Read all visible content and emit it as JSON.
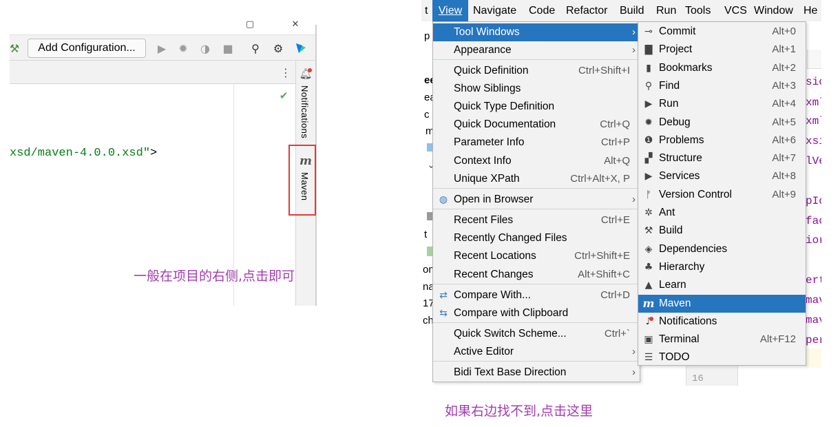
{
  "left": {
    "add_config_label": "Add Configuration...",
    "code_text": "xsd/maven-4.0.0.xsd\"",
    "code_end": ">",
    "notifications_label": "Notifications",
    "maven_label": "Maven",
    "maven_glyph": "m",
    "caption": "一般在项目的右侧,点击即可",
    "check_glyph": "✔",
    "highlight_color": "#e53935"
  },
  "menubar": {
    "items": [
      "t",
      "View",
      "Navigate",
      "Code",
      "Refactor",
      "Build",
      "Run",
      "Tools",
      "VCS",
      "Window",
      "He"
    ]
  },
  "background_fragments": {
    "left_chars": [
      "p",
      "ee",
      "ea",
      "c",
      "m",
      "t",
      "om",
      "na",
      "17",
      "ch"
    ],
    "code_chars": [
      "sic",
      "xml",
      "xml",
      "xsi",
      "lVe",
      "pIc",
      "fac",
      "ior",
      "ert",
      "mav",
      "mav",
      "per"
    ],
    "line_number": "16"
  },
  "view_menu": {
    "items": [
      {
        "label": "Tool Windows",
        "shortcut": "",
        "submenu": true,
        "selected": true
      },
      {
        "label": "Appearance",
        "shortcut": "",
        "submenu": true
      },
      {
        "label": "Quick Definition",
        "shortcut": "Ctrl+Shift+I"
      },
      {
        "label": "Show Siblings",
        "shortcut": ""
      },
      {
        "label": "Quick Type Definition",
        "shortcut": ""
      },
      {
        "label": "Quick Documentation",
        "shortcut": "Ctrl+Q"
      },
      {
        "label": "Parameter Info",
        "shortcut": "Ctrl+P"
      },
      {
        "label": "Context Info",
        "shortcut": "Alt+Q"
      },
      {
        "label": "Unique XPath",
        "shortcut": "Ctrl+Alt+X, P"
      },
      {
        "label": "Open in Browser",
        "shortcut": "",
        "submenu": true,
        "icon": "globe-icon"
      },
      {
        "label": "Recent Files",
        "shortcut": "Ctrl+E"
      },
      {
        "label": "Recently Changed Files",
        "shortcut": ""
      },
      {
        "label": "Recent Locations",
        "shortcut": "Ctrl+Shift+E"
      },
      {
        "label": "Recent Changes",
        "shortcut": "Alt+Shift+C"
      },
      {
        "label": "Compare With...",
        "shortcut": "Ctrl+D",
        "icon": "compare-icon"
      },
      {
        "label": "Compare with Clipboard",
        "shortcut": "",
        "icon": "compare-clipboard-icon"
      },
      {
        "label": "Quick Switch Scheme...",
        "shortcut": "Ctrl+`"
      },
      {
        "label": "Active Editor",
        "shortcut": "",
        "submenu": true
      },
      {
        "label": "Bidi Text Base Direction",
        "shortcut": "",
        "submenu": true
      }
    ]
  },
  "tool_windows_menu": {
    "items": [
      {
        "label": "Commit",
        "shortcut": "Alt+0",
        "icon": "commit-icon"
      },
      {
        "label": "Project",
        "shortcut": "Alt+1",
        "icon": "folder-icon"
      },
      {
        "label": "Bookmarks",
        "shortcut": "Alt+2",
        "icon": "bookmark-icon"
      },
      {
        "label": "Find",
        "shortcut": "Alt+3",
        "icon": "search-icon"
      },
      {
        "label": "Run",
        "shortcut": "Alt+4",
        "icon": "run-icon"
      },
      {
        "label": "Debug",
        "shortcut": "Alt+5",
        "icon": "debug-icon"
      },
      {
        "label": "Problems",
        "shortcut": "Alt+6",
        "icon": "problems-icon"
      },
      {
        "label": "Structure",
        "shortcut": "Alt+7",
        "icon": "structure-icon"
      },
      {
        "label": "Services",
        "shortcut": "Alt+8",
        "icon": "services-icon"
      },
      {
        "label": "Version Control",
        "shortcut": "Alt+9",
        "icon": "vcs-icon"
      },
      {
        "label": "Ant",
        "shortcut": "",
        "icon": "ant-icon"
      },
      {
        "label": "Build",
        "shortcut": "",
        "icon": "hammer-icon"
      },
      {
        "label": "Dependencies",
        "shortcut": "",
        "icon": "dependencies-icon"
      },
      {
        "label": "Hierarchy",
        "shortcut": "",
        "icon": "hierarchy-icon"
      },
      {
        "label": "Learn",
        "shortcut": "",
        "icon": "learn-icon"
      },
      {
        "label": "Maven",
        "shortcut": "",
        "icon": "maven-icon",
        "selected": true
      },
      {
        "label": "Notifications",
        "shortcut": "",
        "icon": "notification-icon"
      },
      {
        "label": "Terminal",
        "shortcut": "Alt+F12",
        "icon": "terminal-icon"
      },
      {
        "label": "TODO",
        "shortcut": "",
        "icon": "todo-icon"
      }
    ]
  },
  "right_caption": "如果右边找不到,点击这里",
  "colors": {
    "selection": "#2675bf",
    "caption": "#a33cb0",
    "menu_bg": "#f2f2f2"
  }
}
